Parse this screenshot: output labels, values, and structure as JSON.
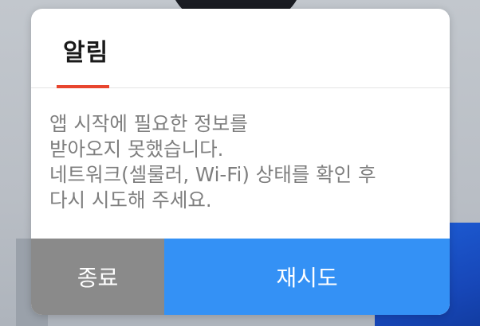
{
  "dialog": {
    "title": "알림",
    "message_lines": [
      "앱 시작에 필요한 정보를",
      "받아오지 못했습니다.",
      "네트워크(셀룰러, Wi-Fi) 상태를 확인 후",
      "다시 시도해 주세요."
    ],
    "exit_label": "종료",
    "retry_label": "재시도"
  },
  "colors": {
    "accent_underline": "#e8452e",
    "exit_button": "#8a8a8a",
    "retry_button": "#3491f5"
  }
}
